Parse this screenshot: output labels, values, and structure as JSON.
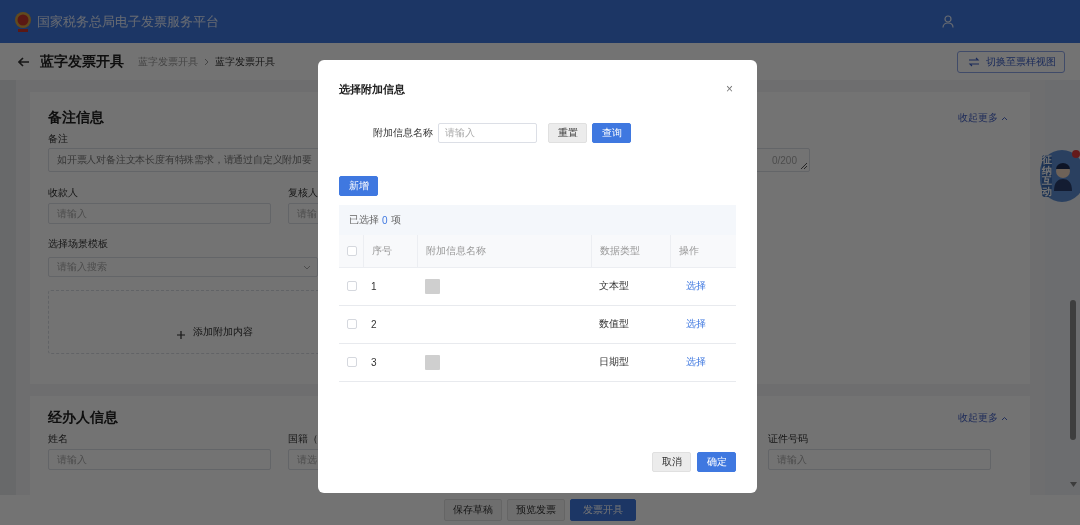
{
  "header": {
    "title": "国家税务总局电子发票服务平台"
  },
  "page_bar": {
    "title": "蓝字发票开具",
    "breadcrumb": [
      "蓝字发票开具",
      "蓝字发票开具"
    ],
    "switch_button": "切换至票样视图"
  },
  "sections": [
    {
      "title": "备注信息",
      "collapse_link": "收起更多",
      "rows": [
        [
          {
            "kind": "textarea",
            "label": "备注",
            "placeholder": "如开票人对备注文本长度有特殊需求，请通过自定义附加要",
            "counter": "0/200"
          }
        ],
        [
          {
            "kind": "input",
            "label": "收款人",
            "placeholder": "请输入"
          },
          {
            "kind": "input",
            "label": "复核人",
            "placeholder": "请输"
          }
        ],
        [
          {
            "kind": "select",
            "label": "选择场景模板",
            "placeholder": "请输入搜索"
          }
        ],
        [
          {
            "kind": "add",
            "text": "添加附加内容"
          }
        ]
      ]
    },
    {
      "title": "经办人信息",
      "collapse_link": "收起更多",
      "rows": [
        [
          {
            "kind": "input",
            "label": "姓名",
            "placeholder": "请输入"
          },
          {
            "kind": "input",
            "label": "国籍（",
            "placeholder": "请选"
          },
          {
            "kind": "input",
            "label": "证件号码",
            "placeholder": "请输入"
          }
        ]
      ]
    }
  ],
  "bottom_buttons": [
    {
      "label": "保存草稿",
      "primary": false
    },
    {
      "label": "预览发票",
      "primary": false
    },
    {
      "label": "发票开具",
      "primary": true
    }
  ],
  "assistant": {
    "label": "征纳互动"
  },
  "dialog": {
    "title": "选择附加信息",
    "close": "×",
    "search_label": "附加信息名称",
    "search_placeholder": "请输入",
    "reset_button": "重置",
    "query_button": "查询",
    "add_button": "新增",
    "selection": {
      "prefix": "已选择",
      "count": "0",
      "suffix": "项"
    },
    "columns": [
      "序号",
      "附加信息名称",
      "数据类型",
      "操作"
    ],
    "all_checked": false,
    "rows": [
      {
        "index": "1",
        "thumbnail": true,
        "type": "文本型",
        "action": "选择",
        "checked": false
      },
      {
        "index": "2",
        "thumbnail": false,
        "type": "数值型",
        "action": "选择",
        "checked": false
      },
      {
        "index": "3",
        "thumbnail": true,
        "type": "日期型",
        "action": "选择",
        "checked": false
      }
    ],
    "cancel_button": "取消",
    "confirm_button": "确定"
  }
}
